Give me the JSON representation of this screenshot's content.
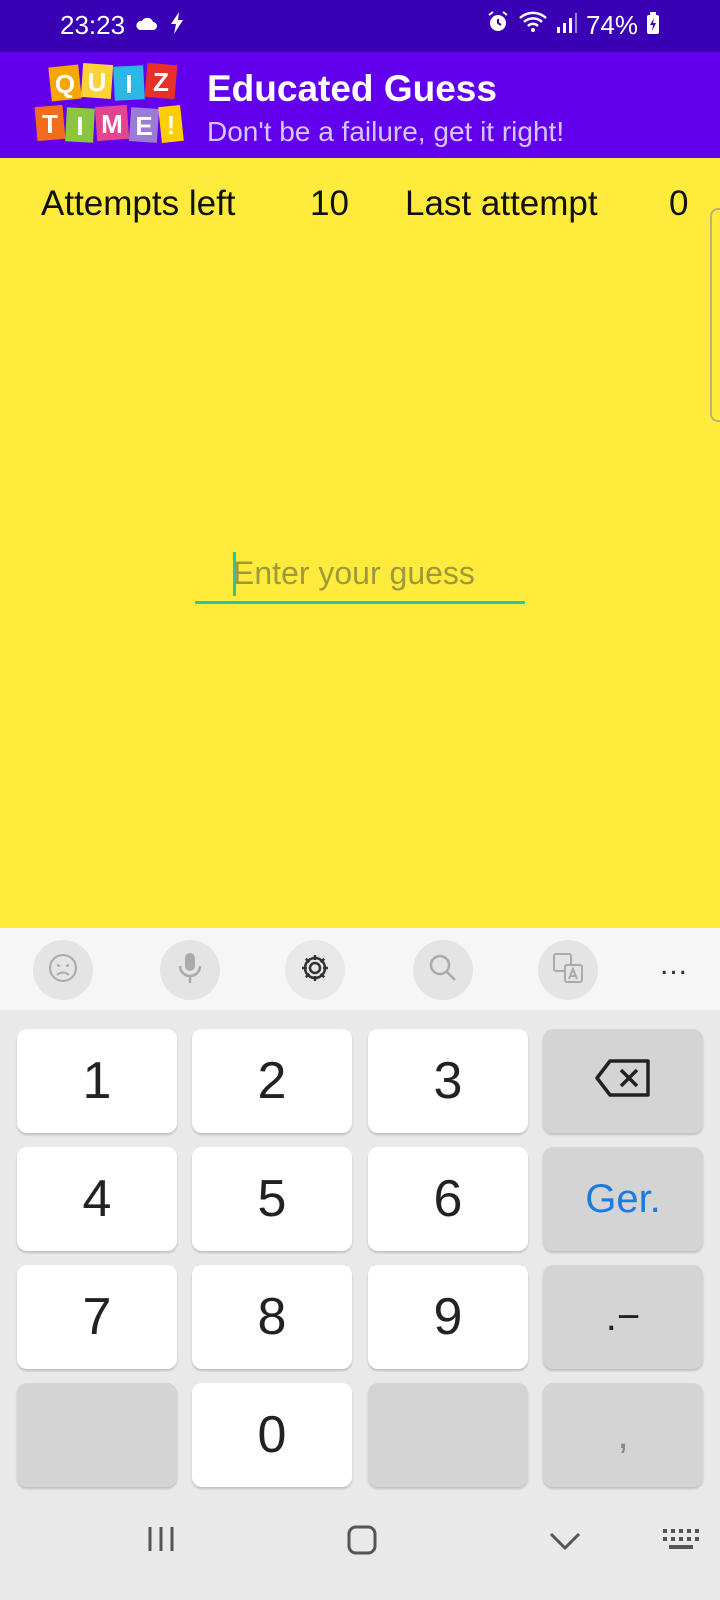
{
  "status_bar": {
    "time": "23:23",
    "battery": "74%",
    "icons": [
      "cloud-icon",
      "charging-bolt-icon",
      "alarm-icon",
      "wifi-icon",
      "signal-icon",
      "battery-icon"
    ]
  },
  "app_bar": {
    "logo_letters": [
      "Q",
      "U",
      "I",
      "Z",
      "T",
      "I",
      "M",
      "E",
      "!"
    ],
    "title": "Educated Guess",
    "subtitle": "Don't be a failure, get it right!"
  },
  "stats": {
    "attempts_left_label": "Attempts left",
    "attempts_left_value": "10",
    "last_attempt_label": "Last attempt",
    "last_attempt_value": "0"
  },
  "guess_input": {
    "placeholder": "Enter your guess",
    "value": ""
  },
  "keyboard_toolbar": {
    "items": [
      "emoji-icon",
      "microphone-icon",
      "settings-icon",
      "search-icon",
      "translate-icon",
      "more-icon"
    ],
    "more_label": "..."
  },
  "keyboard": {
    "keys": {
      "k1": "1",
      "k2": "2",
      "k3": "3",
      "k4": "4",
      "k5": "5",
      "k6": "6",
      "k7": "7",
      "k8": "8",
      "k9": "9",
      "k0": "0",
      "next": "Ger.",
      "dot_dash": ".−",
      "comma": ","
    }
  },
  "colors": {
    "status_bar": "#3a00b4",
    "app_bar": "#6200ee",
    "background": "#ffeb3b",
    "accent": "#26c6a8",
    "keyboard_bg": "#e9e9e9"
  }
}
